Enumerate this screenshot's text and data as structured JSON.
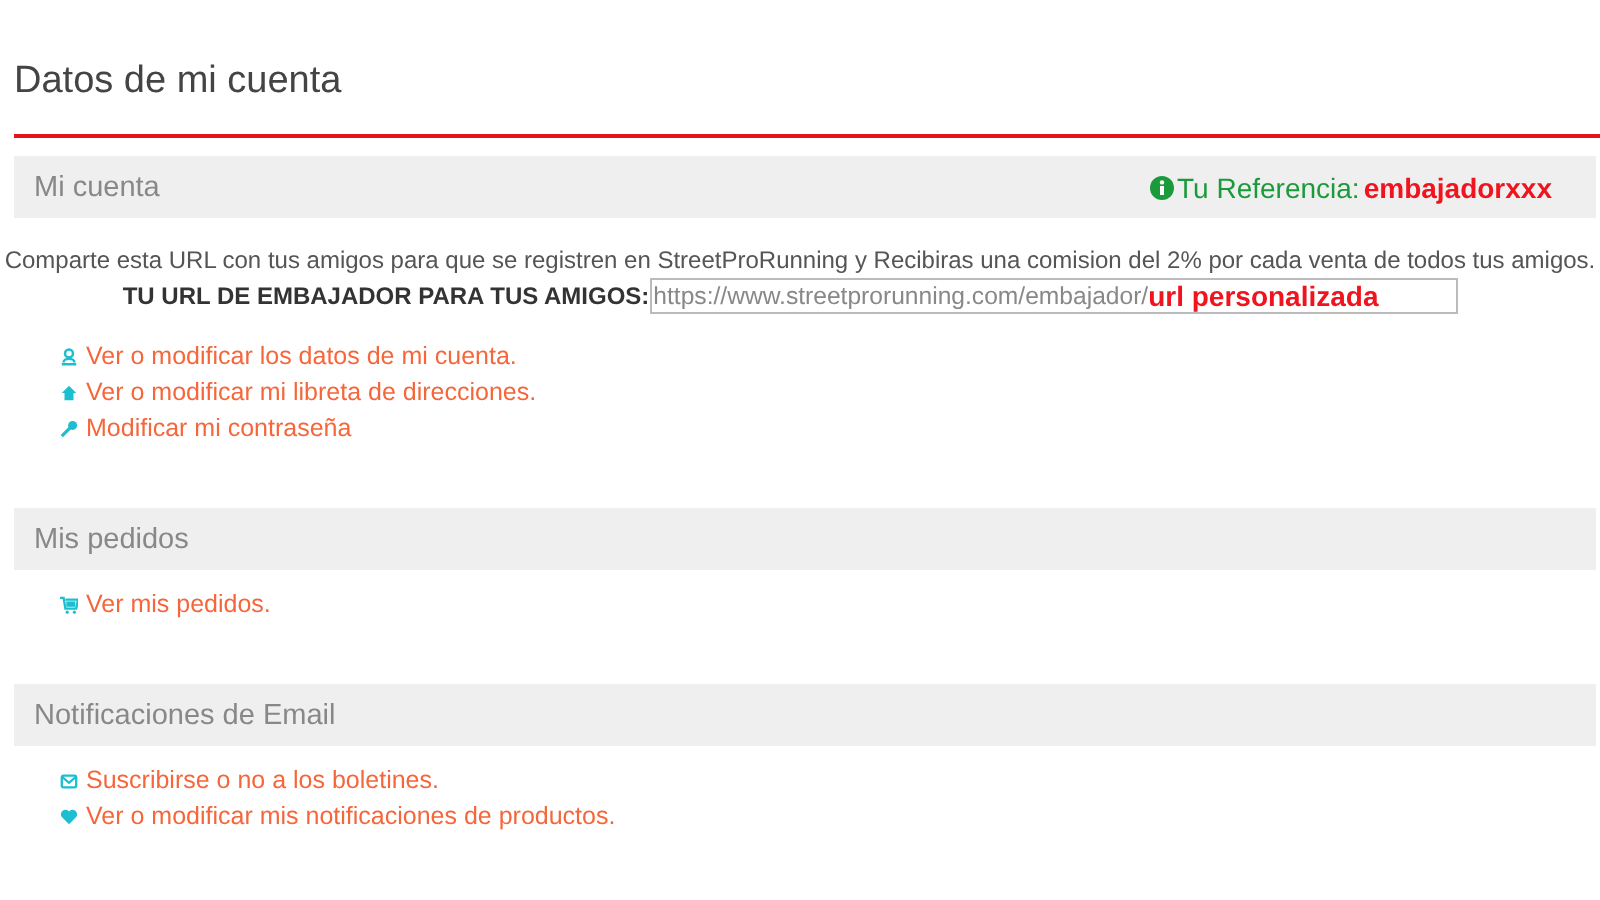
{
  "page_title": "Datos de mi cuenta",
  "sections": [
    {
      "title": "Mi cuenta",
      "reference": {
        "label": "Tu Referencia:",
        "value": "embajadorxxx"
      },
      "intro": "Comparte esta URL con tus amigos para que se registren en StreetProRunning y Recibiras una comision del 2% por cada venta de todos tus amigos.",
      "url_label": "TU URL DE EMBAJADOR PARA TUS AMIGOS:",
      "url_field": {
        "base": "https://www.streetprorunning.com/embajador/",
        "custom": "url personalizada"
      },
      "links": [
        {
          "kind": "user",
          "label": "Ver o modificar los datos de mi cuenta."
        },
        {
          "kind": "home",
          "label": "Ver o modificar mi libreta de direcciones."
        },
        {
          "kind": "key",
          "label": "Modificar mi contraseña"
        }
      ]
    },
    {
      "title": "Mis pedidos",
      "links": [
        {
          "kind": "cart",
          "label": "Ver mis pedidos."
        }
      ]
    },
    {
      "title": "Notificaciones de Email",
      "links": [
        {
          "kind": "mail",
          "label": "Suscribirse o no a los boletines."
        },
        {
          "kind": "heart",
          "label": "Ver o modificar mis notificaciones de productos."
        }
      ]
    }
  ]
}
